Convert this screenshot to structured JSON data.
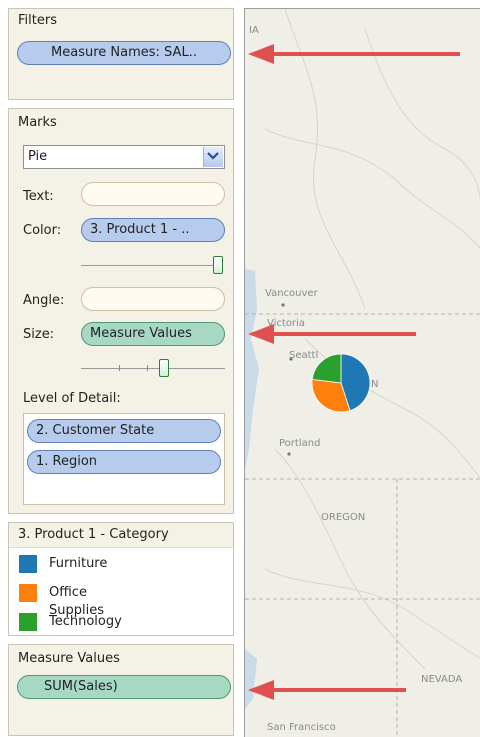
{
  "filters": {
    "title": "Filters",
    "pill": "Measure Names: SAL.."
  },
  "marks": {
    "title": "Marks",
    "mark_type": "Pie",
    "text_label": "Text:",
    "color_label": "Color:",
    "color_pill": "3. Product 1 - ..",
    "angle_label": "Angle:",
    "size_label": "Size:",
    "size_pill": "Measure Values",
    "lod_title": "Level of Detail:",
    "lod_items": [
      "2. Customer State",
      "1. Region"
    ]
  },
  "legend": {
    "title": "3. Product 1 - Category",
    "items": [
      {
        "label": "Furniture",
        "color": "#1f77b4"
      },
      {
        "label": "Office Supplies",
        "color": "#ff7f0e"
      },
      {
        "label": "Technology",
        "color": "#2ca02c"
      }
    ]
  },
  "measure_values": {
    "title": "Measure Values",
    "pill": "SUM(Sales)"
  },
  "map": {
    "labels": {
      "corner": "IA",
      "vancouver": "Vancouver",
      "victoria": "Victoria",
      "seattle": "Seattl",
      "wa": "N",
      "portland": "Portland",
      "oregon": "OREGON",
      "nevada": "NEVADA",
      "san_francisco": "San Francisco"
    },
    "pie": {
      "shares": [
        0.45,
        0.32,
        0.23
      ],
      "colors": [
        "#1f77b4",
        "#ff7f0e",
        "#2ca02c"
      ]
    },
    "arrow_color": "#e0504f"
  }
}
